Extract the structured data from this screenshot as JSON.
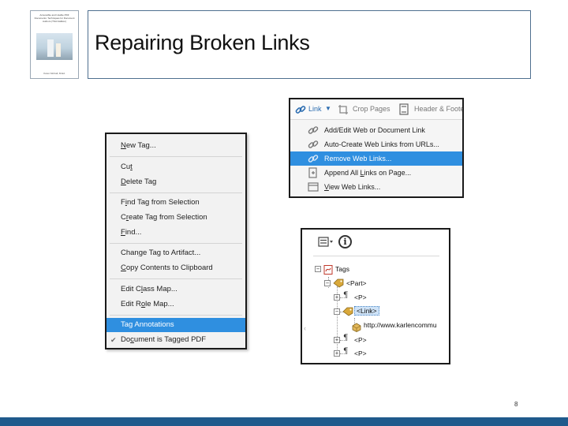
{
  "slide": {
    "title": "Repairing Broken Links",
    "page_number": "8",
    "colors": {
      "footer": "#1f5a8c",
      "title_border": "#4f6f8f",
      "highlight": "#2f8fe0"
    }
  },
  "book_thumbnail": {
    "title": "Accessible and Usable PDF Documents: Techniques for Document Authors (Third Edition)",
    "author": "Karen McCall, M.Ed."
  },
  "context_menu": {
    "items": [
      {
        "pre": "",
        "u": "N",
        "post": "ew Tag..."
      },
      {
        "pre": "Cu",
        "u": "t",
        "post": ""
      },
      {
        "pre": "",
        "u": "D",
        "post": "elete Tag"
      },
      {
        "pre": "F",
        "u": "i",
        "post": "nd Tag from Selection"
      },
      {
        "pre": "C",
        "u": "r",
        "post": "eate Tag from Selection"
      },
      {
        "pre": "",
        "u": "F",
        "post": "ind..."
      },
      {
        "pre": "Chan",
        "u": "g",
        "post": "e Tag to Artifact..."
      },
      {
        "pre": "",
        "u": "C",
        "post": "opy Contents to Clipboard"
      },
      {
        "pre": "Edit C",
        "u": "l",
        "post": "ass Map..."
      },
      {
        "pre": "Edit R",
        "u": "o",
        "post": "le Map..."
      },
      {
        "pre": "Tag Annotations",
        "u": "",
        "post": ""
      },
      {
        "pre": "Do",
        "u": "c",
        "post": "ument is Tagged PDF"
      }
    ],
    "checkmark": "✔"
  },
  "link_menu": {
    "toolbar": {
      "link_label": "Link",
      "caret": "▼",
      "crop_label": "Crop Pages",
      "header_label": "Header & Footer"
    },
    "items": [
      {
        "pre": "Add/Edit Web or Document Link",
        "u": "",
        "post": ""
      },
      {
        "pre": "Auto-Create Web Links from URLs...",
        "u": "",
        "post": ""
      },
      {
        "pre": "Remove Web Links...",
        "u": "",
        "post": ""
      },
      {
        "pre": "Append All ",
        "u": "L",
        "post": "inks on Page..."
      },
      {
        "pre": "",
        "u": "V",
        "post": "iew Web Links..."
      }
    ]
  },
  "tags_panel": {
    "options_caret": "▾",
    "info_glyph": "i",
    "tree": {
      "root": "Tags",
      "part": "<Part>",
      "p1": "<P>",
      "link": "<Link>",
      "url": "http://www.karlencommu",
      "p2": "<P>",
      "p3": "<P>"
    },
    "toggle_minus": "−",
    "toggle_plus": "+",
    "para_glyph": "¶",
    "scroll_mark": "‹"
  }
}
